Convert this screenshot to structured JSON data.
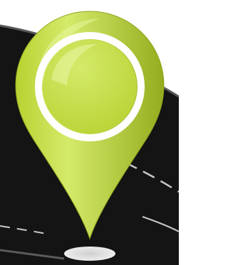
{
  "image": {
    "subject": "location-pin-icon",
    "colors": {
      "background": "#ffffff",
      "road_surface": "#141414",
      "road_edge": "#5a5a5a",
      "lane_marking": "#c8c8c8",
      "pin_light": "#d4ea6a",
      "pin_mid": "#b8d232",
      "pin_dark": "#94ad1e",
      "pin_ring": "#ffffff",
      "shadow": "#d9d9d9"
    }
  }
}
